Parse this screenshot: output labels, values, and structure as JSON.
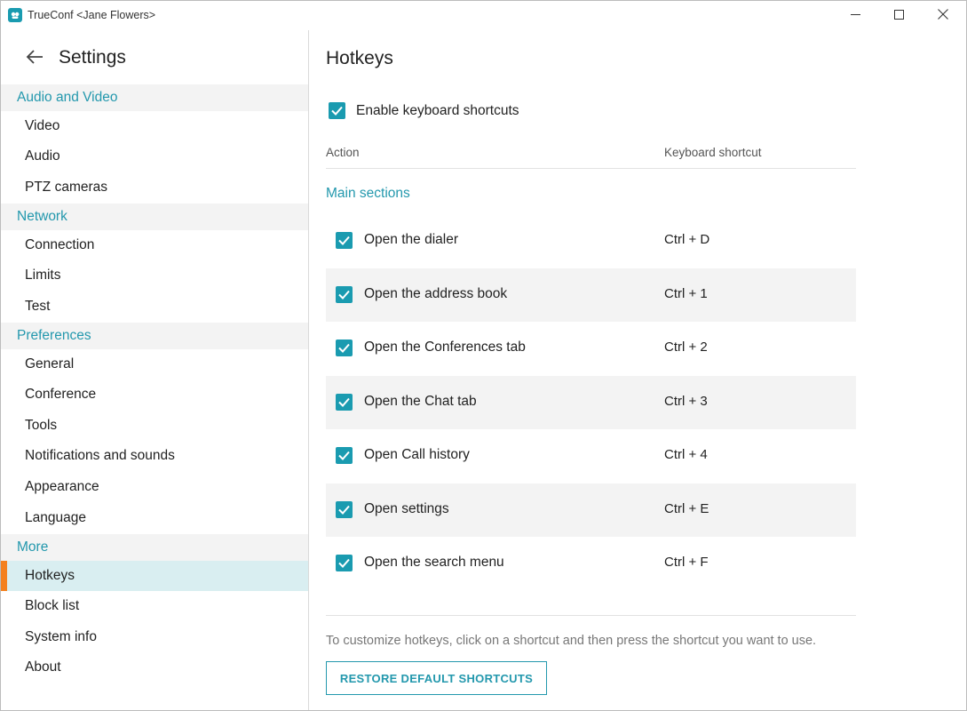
{
  "window": {
    "title": "TrueConf <Jane Flowers>"
  },
  "sidebar": {
    "title": "Settings",
    "sections": [
      {
        "label": "Audio and Video",
        "items": [
          "Video",
          "Audio",
          "PTZ cameras"
        ]
      },
      {
        "label": "Network",
        "items": [
          "Connection",
          "Limits",
          "Test"
        ]
      },
      {
        "label": "Preferences",
        "items": [
          "General",
          "Conference",
          "Tools",
          "Notifications and sounds",
          "Appearance",
          "Language"
        ]
      },
      {
        "label": "More",
        "items": [
          "Hotkeys",
          "Block list",
          "System info",
          "About"
        ]
      }
    ],
    "active_item": "Hotkeys"
  },
  "main": {
    "title": "Hotkeys",
    "enable_label": "Enable keyboard shortcuts",
    "enable_checked": true,
    "columns": {
      "action": "Action",
      "shortcut": "Keyboard shortcut"
    },
    "group_label": "Main sections",
    "rows": [
      {
        "action": "Open the dialer",
        "shortcut": "Ctrl + D",
        "checked": true
      },
      {
        "action": "Open the address book",
        "shortcut": "Ctrl + 1",
        "checked": true
      },
      {
        "action": "Open the Conferences tab",
        "shortcut": "Ctrl + 2",
        "checked": true
      },
      {
        "action": "Open the Chat tab",
        "shortcut": "Ctrl + 3",
        "checked": true
      },
      {
        "action": "Open Call history",
        "shortcut": "Ctrl + 4",
        "checked": true
      },
      {
        "action": "Open settings",
        "shortcut": "Ctrl + E",
        "checked": true
      },
      {
        "action": "Open the search menu",
        "shortcut": "Ctrl + F",
        "checked": true
      }
    ],
    "hint": "To customize hotkeys, click on a shortcut and then press the shortcut you want to use.",
    "restore_label": "RESTORE DEFAULT SHORTCUTS"
  },
  "colors": {
    "accent": "#1a9bb0",
    "active_marker": "#f4811f",
    "active_bg": "#d9eef1",
    "section_bg": "#f3f3f3"
  },
  "icons": {
    "app": "trueconf-logo-icon",
    "back": "arrow-left-icon",
    "checkbox": "checkmark-icon"
  }
}
